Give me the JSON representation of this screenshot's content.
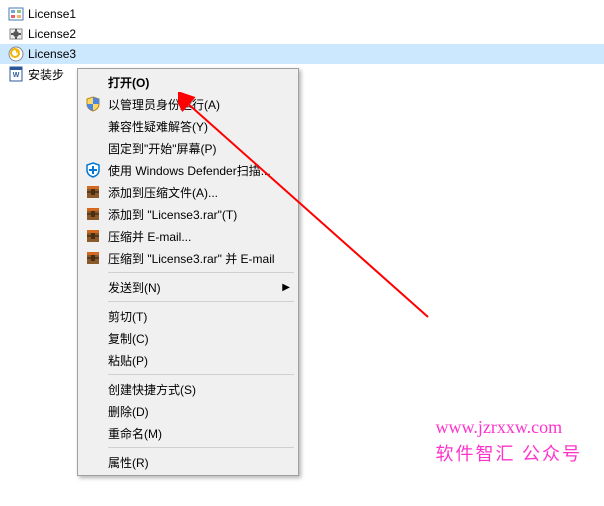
{
  "files": [
    {
      "name": "License1",
      "icon": "reg-icon"
    },
    {
      "name": "License2",
      "icon": "setup-icon"
    },
    {
      "name": "License3",
      "icon": "bat-icon"
    },
    {
      "name": "安装步",
      "icon": "word-icon"
    }
  ],
  "menu": {
    "open": "打开(O)",
    "run_admin": "以管理员身份运行(A)",
    "compat": "兼容性疑难解答(Y)",
    "pin_start": "固定到\"开始\"屏幕(P)",
    "defender": "使用 Windows Defender扫描...",
    "add_archive": "添加到压缩文件(A)...",
    "add_rar": "添加到 \"License3.rar\"(T)",
    "compress_email": "压缩并 E-mail...",
    "compress_rar_email": "压缩到 \"License3.rar\" 并 E-mail",
    "send_to": "发送到(N)",
    "cut": "剪切(T)",
    "copy": "复制(C)",
    "paste": "粘贴(P)",
    "shortcut": "创建快捷方式(S)",
    "delete": "删除(D)",
    "rename": "重命名(M)",
    "properties": "属性(R)"
  },
  "watermark": {
    "line1": "www.jzrxxw.com",
    "line2": "软件智汇 公众号"
  }
}
